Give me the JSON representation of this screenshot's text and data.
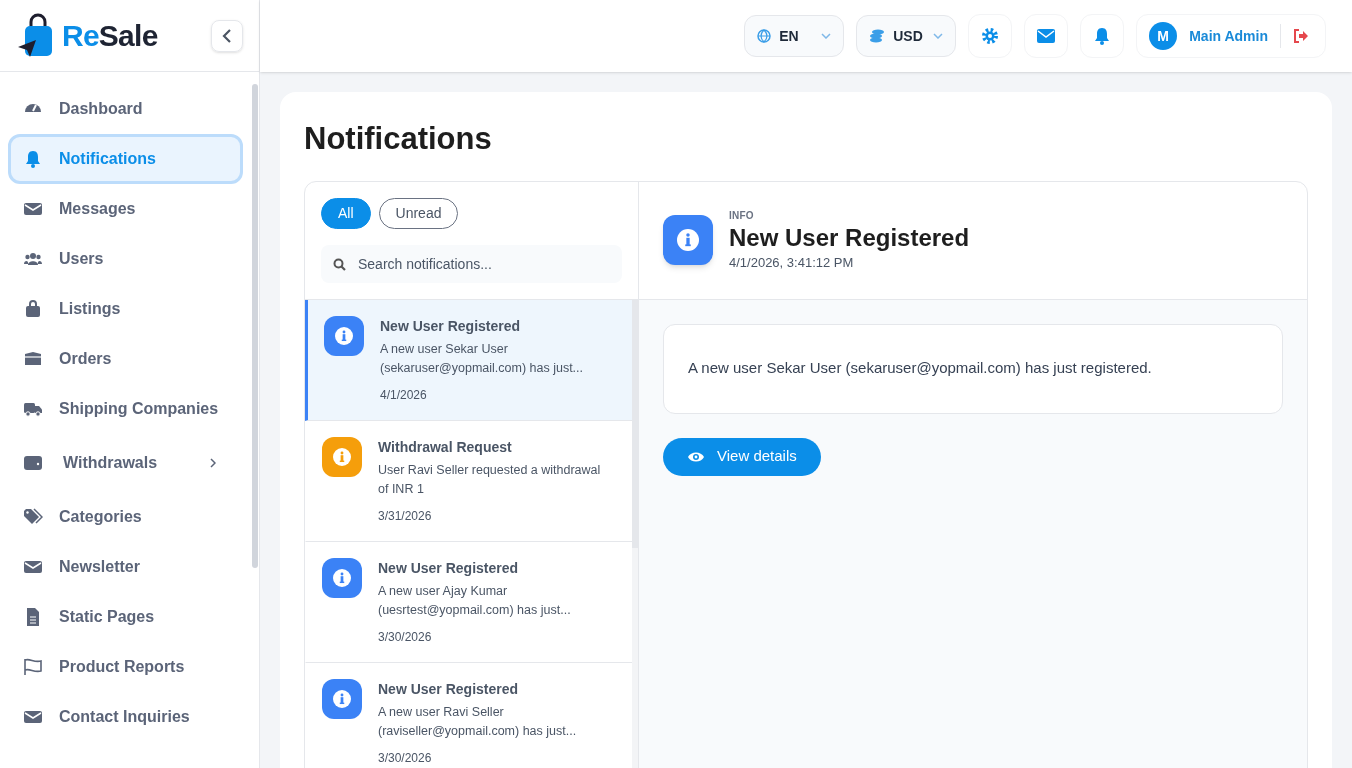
{
  "logo": {
    "accent": "Re",
    "rest": "Sale"
  },
  "header": {
    "language": "EN",
    "currency": "USD",
    "user": {
      "initial": "M",
      "name": "Main Admin"
    }
  },
  "sidebar": {
    "items": [
      {
        "label": "Dashboard",
        "selected": false
      },
      {
        "label": "Notifications",
        "selected": true
      },
      {
        "label": "Messages",
        "selected": false
      },
      {
        "label": "Users",
        "selected": false
      },
      {
        "label": "Listings",
        "selected": false
      },
      {
        "label": "Orders",
        "selected": false
      },
      {
        "label": "Shipping Companies",
        "selected": false
      },
      {
        "label": "Withdrawals",
        "selected": false,
        "has_submenu": true
      },
      {
        "label": "Categories",
        "selected": false
      },
      {
        "label": "Newsletter",
        "selected": false
      },
      {
        "label": "Static Pages",
        "selected": false
      },
      {
        "label": "Product Reports",
        "selected": false
      },
      {
        "label": "Contact Inquiries",
        "selected": false
      }
    ]
  },
  "page_title": "Notifications",
  "filters": [
    {
      "label": "All",
      "selected": true
    },
    {
      "label": "Unread",
      "selected": false
    }
  ],
  "search": {
    "placeholder": "Search notifications..."
  },
  "notifications": [
    {
      "kind": "info",
      "title": "New User Registered",
      "text": "A new user Sekar User (sekaruser@yopmail.com) has just...",
      "date": "4/1/2026",
      "selected": true
    },
    {
      "kind": "warning",
      "title": "Withdrawal Request",
      "text": "User Ravi Seller requested a withdrawal of INR 1",
      "date": "3/31/2026",
      "selected": false
    },
    {
      "kind": "info",
      "title": "New User Registered",
      "text": "A new user Ajay Kumar (uesrtest@yopmail.com) has just...",
      "date": "3/30/2026",
      "selected": false
    },
    {
      "kind": "info",
      "title": "New User Registered",
      "text": "A new user Ravi Seller (raviseller@yopmail.com) has just...",
      "date": "3/30/2026",
      "selected": false
    }
  ],
  "detail": {
    "kind": "info",
    "type_label": "INFO",
    "title": "New User Registered",
    "timestamp": "4/1/2026, 3:41:12 PM",
    "message": "A new user Sekar User (sekaruser@yopmail.com) has just registered.",
    "action": "View details"
  }
}
